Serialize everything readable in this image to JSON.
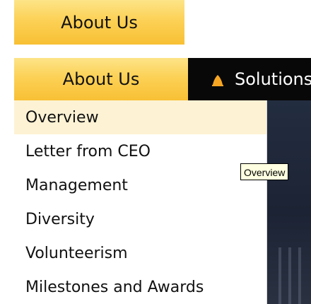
{
  "top_tab": {
    "label": "About Us"
  },
  "nav": {
    "about_label": "About Us",
    "solutions_label": "Solutions",
    "solutions_icon": "bell-icon"
  },
  "dropdown": {
    "items": [
      {
        "label": "Overview",
        "active": true
      },
      {
        "label": "Letter from CEO"
      },
      {
        "label": "Management"
      },
      {
        "label": "Diversity"
      },
      {
        "label": "Volunteerism"
      },
      {
        "label": "Milestones and Awards"
      }
    ]
  },
  "tooltip": {
    "text": "Overview"
  },
  "colors": {
    "tab_yellow": "#fcd156",
    "nav_black": "#080808",
    "hover_highlight": "#fdf2d4",
    "tooltip_bg": "#ffffe1"
  }
}
